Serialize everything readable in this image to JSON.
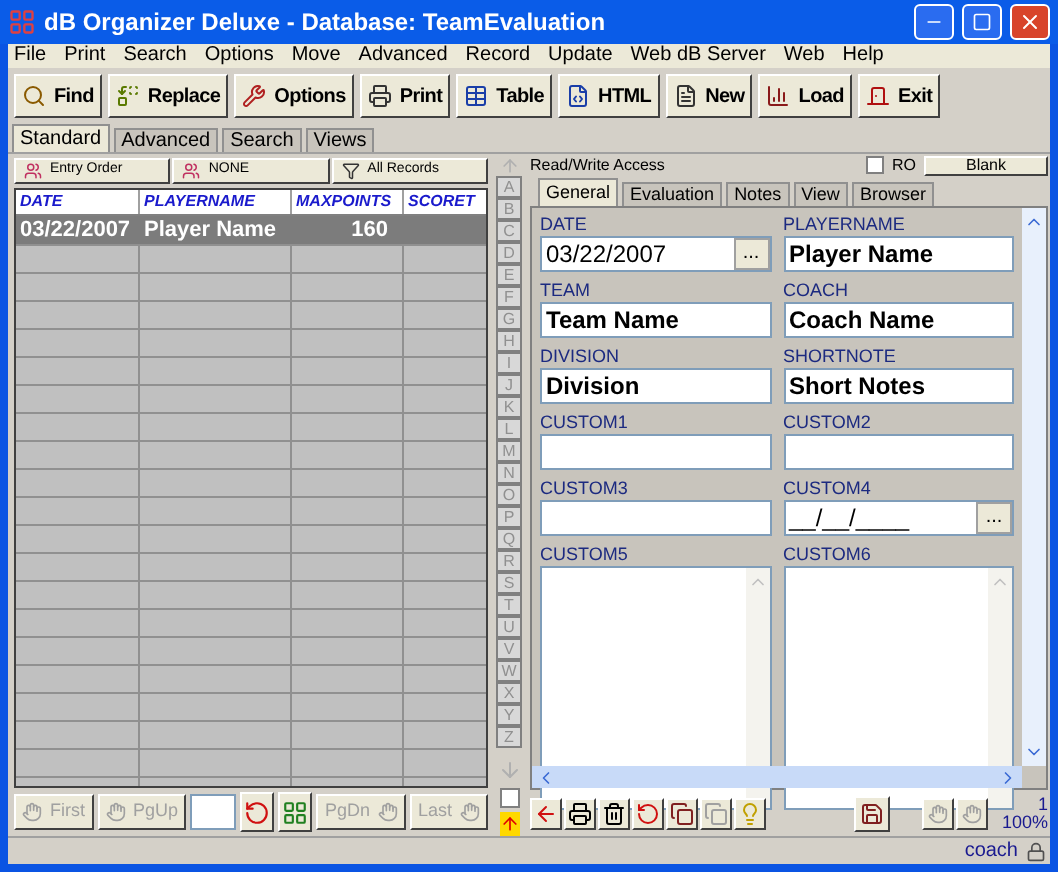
{
  "window": {
    "title": "dB Organizer Deluxe - Database: TeamEvaluation"
  },
  "menu": [
    "File",
    "Print",
    "Search",
    "Options",
    "Move",
    "Advanced",
    "Record",
    "Update",
    "Web dB Server",
    "Web",
    "Help"
  ],
  "toolbar": [
    {
      "label": "Find",
      "kind": "find"
    },
    {
      "label": "Replace",
      "kind": "replace"
    },
    {
      "label": "Options",
      "kind": "options"
    },
    {
      "label": "Print",
      "kind": "print"
    },
    {
      "label": "Table",
      "kind": "table"
    },
    {
      "label": "HTML",
      "kind": "html"
    },
    {
      "label": "New",
      "kind": "new"
    },
    {
      "label": "Load",
      "kind": "load"
    },
    {
      "label": "Exit",
      "kind": "exit"
    }
  ],
  "tabs": [
    {
      "label": "Standard",
      "selected": true
    },
    {
      "label": "Advanced",
      "selected": false
    },
    {
      "label": "Search",
      "selected": false
    },
    {
      "label": "Views",
      "selected": false
    }
  ],
  "sort_buttons": [
    {
      "label": "Entry Order",
      "kind": "sort"
    },
    {
      "label": "NONE",
      "kind": "sort"
    },
    {
      "label": "All Records",
      "kind": "filter"
    }
  ],
  "table": {
    "columns": [
      "DATE",
      "PLAYERNAME",
      "MAXPOINTS",
      "SCORET"
    ],
    "rows": [
      {
        "cells": [
          "03/22/2007",
          "Player Name",
          "160",
          ""
        ],
        "selected": true
      }
    ]
  },
  "navigation": [
    {
      "label": "First",
      "disabled": true
    },
    {
      "label": "PgUp",
      "disabled": true
    },
    {
      "label": "PgDn",
      "disabled": true
    },
    {
      "label": "Last",
      "disabled": true
    }
  ],
  "alphabet": [
    "A",
    "B",
    "C",
    "D",
    "E",
    "F",
    "G",
    "H",
    "I",
    "J",
    "K",
    "L",
    "M",
    "N",
    "O",
    "P",
    "Q",
    "R",
    "S",
    "T",
    "U",
    "V",
    "W",
    "X",
    "Y",
    "Z"
  ],
  "record": {
    "access": "Read/Write Access",
    "ro_label": "RO",
    "ro_checked": false,
    "blank_button": "Blank",
    "tabs": [
      {
        "label": "General",
        "selected": true
      },
      {
        "label": "Evaluation",
        "selected": false
      },
      {
        "label": "Notes",
        "selected": false
      },
      {
        "label": "View",
        "selected": false
      },
      {
        "label": "Browser",
        "selected": false
      }
    ],
    "fields": [
      {
        "label": "DATE",
        "value": "03/22/2007",
        "kind": "date",
        "picker": "..."
      },
      {
        "label": "PLAYERNAME",
        "value": "Player Name",
        "kind": "text"
      },
      {
        "label": "TEAM",
        "value": "Team Name",
        "kind": "text"
      },
      {
        "label": "COACH",
        "value": "Coach Name",
        "kind": "text"
      },
      {
        "label": "DIVISION",
        "value": "Division",
        "kind": "text"
      },
      {
        "label": "SHORTNOTE",
        "value": "Short Notes",
        "kind": "text"
      },
      {
        "label": "CUSTOM1",
        "kind": "text"
      },
      {
        "label": "CUSTOM2",
        "kind": "text"
      },
      {
        "label": "CUSTOM3",
        "kind": "text"
      },
      {
        "label": "CUSTOM4",
        "value": "__/__/____",
        "kind": "date",
        "picker": "..."
      },
      {
        "label": "CUSTOM5",
        "kind": "memo"
      },
      {
        "label": "CUSTOM6",
        "kind": "memo"
      }
    ],
    "record_number": "1",
    "zoom": "100%"
  },
  "sync_checked": false,
  "status_bar": {
    "user": "coach"
  }
}
